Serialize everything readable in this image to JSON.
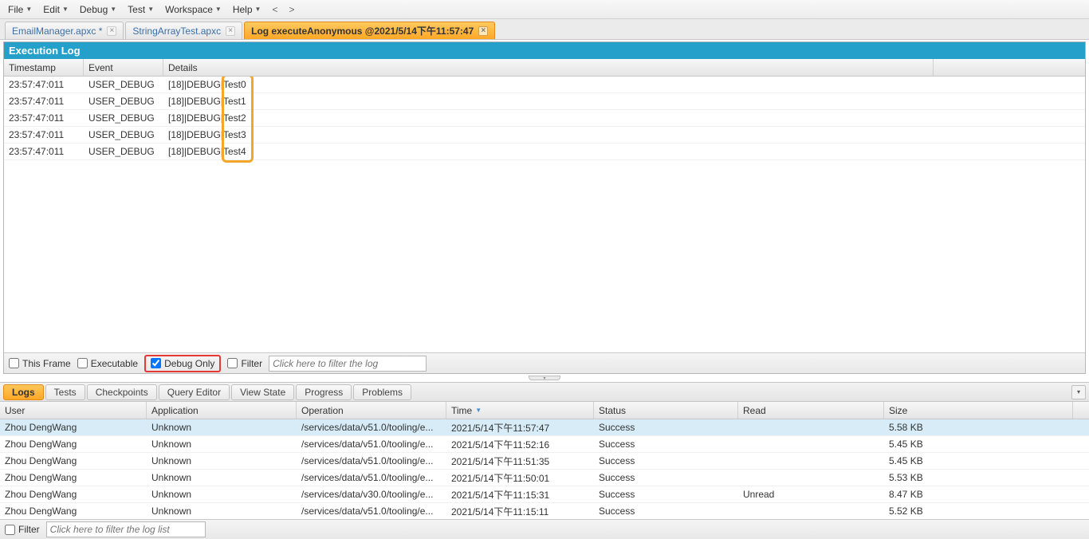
{
  "menu": {
    "items": [
      {
        "label": "File"
      },
      {
        "label": "Edit"
      },
      {
        "label": "Debug"
      },
      {
        "label": "Test"
      },
      {
        "label": "Workspace"
      },
      {
        "label": "Help"
      }
    ],
    "nav_prev": "<",
    "nav_next": ">"
  },
  "tabs": [
    {
      "label": "EmailManager.apxc *",
      "active": false
    },
    {
      "label": "StringArrayTest.apxc",
      "active": false
    },
    {
      "label": "Log executeAnonymous @2021/5/14下午11:57:47",
      "active": true
    }
  ],
  "exec_log": {
    "title": "Execution Log",
    "columns": {
      "timestamp": "Timestamp",
      "event": "Event",
      "details": "Details"
    },
    "rows": [
      {
        "ts": "23:57:47:011",
        "ev": "USER_DEBUG",
        "prefix": "[18]|DEBUG|",
        "msg": "Test0"
      },
      {
        "ts": "23:57:47:011",
        "ev": "USER_DEBUG",
        "prefix": "[18]|DEBUG|",
        "msg": "Test1"
      },
      {
        "ts": "23:57:47:011",
        "ev": "USER_DEBUG",
        "prefix": "[18]|DEBUG|",
        "msg": "Test2"
      },
      {
        "ts": "23:57:47:011",
        "ev": "USER_DEBUG",
        "prefix": "[18]|DEBUG|",
        "msg": "Test3"
      },
      {
        "ts": "23:57:47:011",
        "ev": "USER_DEBUG",
        "prefix": "[18]|DEBUG|",
        "msg": "Test4"
      }
    ],
    "controls": {
      "this_frame": "This Frame",
      "executable": "Executable",
      "debug_only": "Debug Only",
      "filter": "Filter",
      "filter_placeholder": "Click here to filter the log"
    }
  },
  "bottom_tabs": [
    {
      "label": "Logs",
      "active": true
    },
    {
      "label": "Tests",
      "active": false
    },
    {
      "label": "Checkpoints",
      "active": false
    },
    {
      "label": "Query Editor",
      "active": false
    },
    {
      "label": "View State",
      "active": false
    },
    {
      "label": "Progress",
      "active": false
    },
    {
      "label": "Problems",
      "active": false
    }
  ],
  "logs_grid": {
    "columns": {
      "user": "User",
      "application": "Application",
      "operation": "Operation",
      "time": "Time",
      "status": "Status",
      "read": "Read",
      "size": "Size"
    },
    "rows": [
      {
        "user": "Zhou DengWang",
        "application": "Unknown",
        "operation": "/services/data/v51.0/tooling/e...",
        "time": "2021/5/14下午11:57:47",
        "status": "Success",
        "read": "",
        "size": "5.58 KB",
        "selected": true
      },
      {
        "user": "Zhou DengWang",
        "application": "Unknown",
        "operation": "/services/data/v51.0/tooling/e...",
        "time": "2021/5/14下午11:52:16",
        "status": "Success",
        "read": "",
        "size": "5.45 KB",
        "selected": false
      },
      {
        "user": "Zhou DengWang",
        "application": "Unknown",
        "operation": "/services/data/v51.0/tooling/e...",
        "time": "2021/5/14下午11:51:35",
        "status": "Success",
        "read": "",
        "size": "5.45 KB",
        "selected": false
      },
      {
        "user": "Zhou DengWang",
        "application": "Unknown",
        "operation": "/services/data/v51.0/tooling/e...",
        "time": "2021/5/14下午11:50:01",
        "status": "Success",
        "read": "",
        "size": "5.53 KB",
        "selected": false
      },
      {
        "user": "Zhou DengWang",
        "application": "Unknown",
        "operation": "/services/data/v30.0/tooling/e...",
        "time": "2021/5/14下午11:15:31",
        "status": "Success",
        "read": "Unread",
        "size": "8.47 KB",
        "selected": false
      },
      {
        "user": "Zhou DengWang",
        "application": "Unknown",
        "operation": "/services/data/v51.0/tooling/e...",
        "time": "2021/5/14下午11:15:11",
        "status": "Success",
        "read": "",
        "size": "5.52 KB",
        "selected": false
      }
    ],
    "filter_label": "Filter",
    "filter_placeholder": "Click here to filter the log list"
  }
}
